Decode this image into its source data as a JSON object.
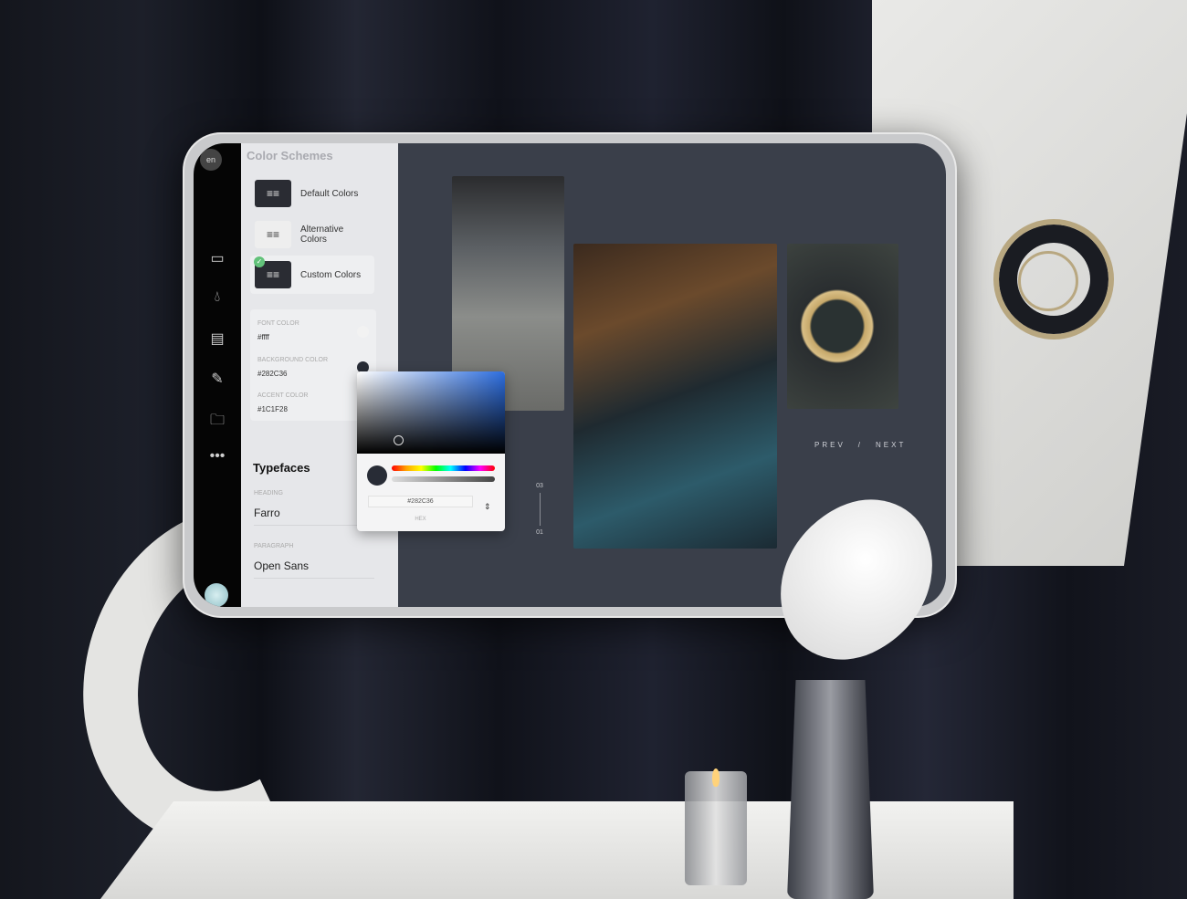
{
  "sidebar": {
    "language": "en",
    "icons": [
      "monitor-icon",
      "droplet-icon",
      "document-icon",
      "pencil-icon",
      "folder-icon",
      "more-icon"
    ]
  },
  "panel": {
    "title": "Color Schemes",
    "schemes": [
      {
        "label": "Default Colors"
      },
      {
        "label": "Alternative Colors"
      },
      {
        "label": "Custom Colors",
        "selected": true
      }
    ],
    "colors": [
      {
        "label": "FONT COLOR",
        "value": "#ffff",
        "swatch": "#f2f2f2"
      },
      {
        "label": "BACKGROUND COLOR",
        "value": "#282C36",
        "swatch": "#282c36"
      },
      {
        "label": "ACCENT COLOR",
        "value": "#1C1F28"
      }
    ],
    "typefaces": {
      "title": "Typefaces",
      "heading_label": "HEADING",
      "heading_value": "Farro",
      "paragraph_label": "PARAGRAPH",
      "paragraph_value": "Open Sans"
    }
  },
  "picker": {
    "hex": "#282C36",
    "mode": "HEX"
  },
  "main": {
    "prev": "PREV",
    "sep": "/",
    "next": "NEXT",
    "counter_current": "01",
    "counter_total": "03",
    "background": "#3a3f4a"
  }
}
